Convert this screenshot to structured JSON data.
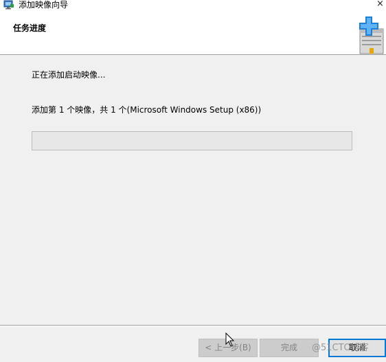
{
  "window": {
    "title": "添加映像向导",
    "close_glyph": "×",
    "app_icon": "wizard-app-icon"
  },
  "header": {
    "heading": "任务进度",
    "icon": "add-image-icon"
  },
  "main": {
    "status_text": "正在添加启动映像...",
    "detail_text": "添加第 1 个映像，共 1 个(Microsoft Windows Setup (x86))",
    "progress_fraction": 0
  },
  "footer": {
    "back_label": "< 上一步(B)",
    "finish_label": "完成",
    "cancel_label": "取消"
  },
  "watermark": "@51CTO博客",
  "colors": {
    "progress_fill": "#06b025",
    "focus_border": "#0078d7",
    "disabled_text": "#838383"
  }
}
